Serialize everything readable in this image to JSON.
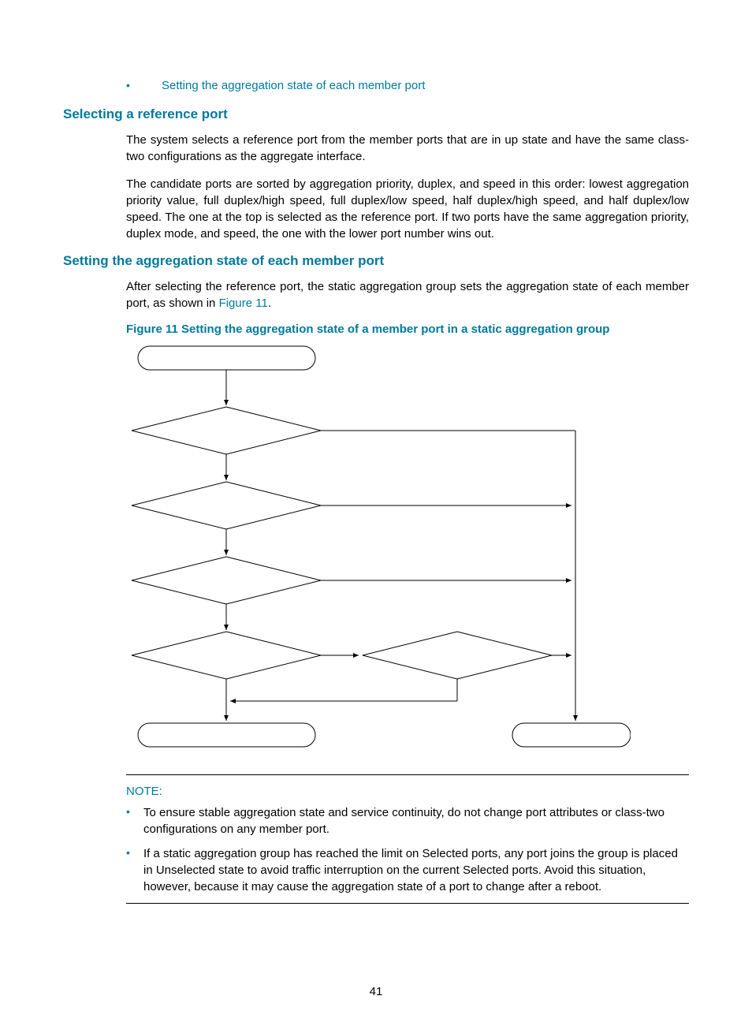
{
  "bullet_link": "Setting the aggregation state of each member port",
  "heading1": "Selecting a reference port",
  "para1": "The system selects a reference port from the member ports that are in up state and have the same class-two configurations as the aggregate interface.",
  "para2": "The candidate ports are sorted by aggregation priority, duplex, and speed in this order: lowest aggregation priority value, full duplex/high speed, full duplex/low speed, half duplex/high speed, and half duplex/low speed. The one at the top is selected as the reference port. If two ports have the same aggregation priority, duplex mode, and speed, the one with the lower port number wins out.",
  "heading2": "Setting the aggregation state of each member port",
  "para3_pre": "After selecting the reference port, the static aggregation group sets the aggregation state of each member port, as shown in ",
  "para3_link": "Figure 11",
  "para3_post": ".",
  "figure_caption": "Figure 11 Setting the aggregation state of a member port in a static aggregation group",
  "note_title": "NOTE:",
  "note_items": [
    "To ensure stable aggregation state and service continuity, do not change port attributes or class-two configurations on any member port.",
    "If a static aggregation group has reached the limit on Selected ports, any port joins the group is placed in Unselected state to avoid traffic interruption on the current Selected ports. Avoid this situation, however, because it may cause the aggregation state of a port to change after a reboot."
  ],
  "page_number": "41"
}
